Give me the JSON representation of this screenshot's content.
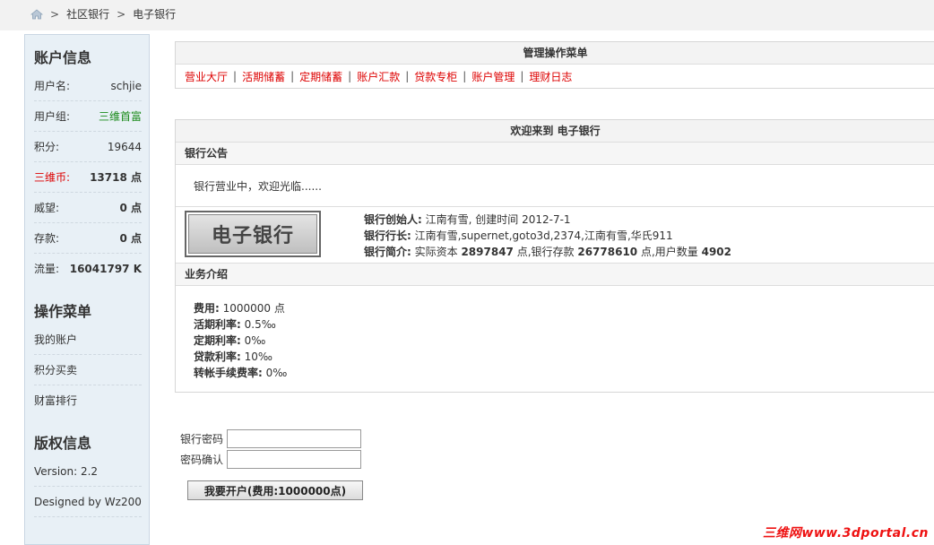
{
  "breadcrumb": {
    "items": [
      "社区银行",
      "电子银行"
    ],
    "sep": ">"
  },
  "sidebar": {
    "account": {
      "title": "账户信息",
      "rows": [
        {
          "label": "用户名:",
          "value": "schjie"
        },
        {
          "label": "用户组:",
          "value": "三维首富"
        },
        {
          "label": "积分:",
          "value": "19644"
        },
        {
          "label": "三维币:",
          "value": "13718 点"
        },
        {
          "label": "威望:",
          "value": "0 点"
        },
        {
          "label": "存款:",
          "value": "0 点"
        },
        {
          "label": "流量:",
          "value": "16041797 K"
        }
      ]
    },
    "ops": {
      "title": "操作菜单",
      "items": [
        "我的账户",
        "积分买卖",
        "财富排行"
      ]
    },
    "copyright": {
      "title": "版权信息",
      "version": "Version: 2.2",
      "designed": "Designed by Wz200..."
    }
  },
  "menu": {
    "title": "管理操作菜单",
    "items": [
      "营业大厅",
      "活期储蓄",
      "定期储蓄",
      "账户汇款",
      "贷款专柜",
      "账户管理",
      "理财日志"
    ],
    "pipe": "|"
  },
  "welcome": {
    "title": "欢迎来到 电子银行",
    "notice_title": "银行公告",
    "notice_text": "银行营业中，欢迎光临......",
    "logo_text": "电子银行",
    "founder_label": "银行创始人:",
    "founder_text": " 江南有雪, 创建时间 2012-7-1",
    "president_label": "银行行长:",
    "president_text": " 江南有雪,supernet,goto3d,2374,江南有雪,华氏911",
    "intro_label": "银行简介:",
    "intro_a": " 实际资本 ",
    "capital": "2897847",
    "intro_b": " 点,银行存款 ",
    "deposit": "26778610",
    "intro_c": " 点,用户数量 ",
    "users": "4902",
    "biz_title": "业务介绍",
    "biz": [
      {
        "label": "费用:",
        "value": " 1000000 点"
      },
      {
        "label": "活期利率:",
        "value": " 0.5‰"
      },
      {
        "label": "定期利率:",
        "value": " 0‰"
      },
      {
        "label": "贷款利率:",
        "value": " 10‰"
      },
      {
        "label": "转帐手续费率:",
        "value": " 0‰"
      }
    ]
  },
  "form": {
    "password_label": "银行密码",
    "confirm_label": "密码确认",
    "submit": "我要开户(费用:1000000点)"
  },
  "watermark": "三维网www.3dportal.cn",
  "colors": {
    "link_red": "#dd0000",
    "group_green": "#1a8a1a",
    "sidebar_bg": "#e8f0f6"
  }
}
